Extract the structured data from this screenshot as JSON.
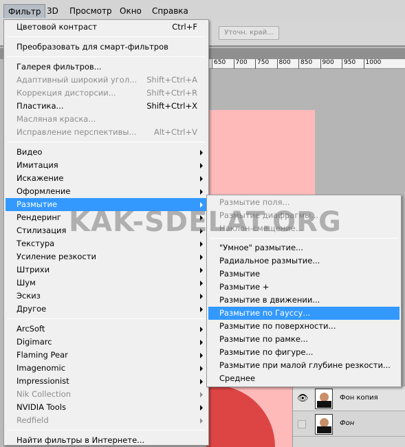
{
  "menubar": [
    "Фильтр",
    "3D",
    "Просмотр",
    "Окно",
    "Справка"
  ],
  "options": {
    "refine_edge": "Уточн. край..."
  },
  "ruler": [
    "650",
    "700",
    "750",
    "800",
    "850",
    "900",
    "950",
    "1000"
  ],
  "watermark": "KAK-SDELAT.ORG",
  "main_menu": [
    {
      "label": "Цветовой контраст",
      "shortcut": "Ctrl+F"
    },
    {
      "sep": true
    },
    {
      "label": "Преобразовать для смарт-фильтров"
    },
    {
      "sep": true
    },
    {
      "label": "Галерея фильтров..."
    },
    {
      "label": "Адаптивный широкий угол...",
      "shortcut": "Shift+Ctrl+A",
      "disabled": true
    },
    {
      "label": "Коррекция дисторсии...",
      "shortcut": "Shift+Ctrl+R",
      "disabled": true
    },
    {
      "label": "Пластика...",
      "shortcut": "Shift+Ctrl+X"
    },
    {
      "label": "Масляная краска...",
      "disabled": true
    },
    {
      "label": "Исправление перспективы...",
      "shortcut": "Alt+Ctrl+V",
      "disabled": true
    },
    {
      "sep": true
    },
    {
      "label": "Видео",
      "submenu": true
    },
    {
      "label": "Имитация",
      "submenu": true
    },
    {
      "label": "Искажение",
      "submenu": true
    },
    {
      "label": "Оформление",
      "submenu": true
    },
    {
      "label": "Размытие",
      "submenu": true,
      "highlighted": true
    },
    {
      "label": "Рендеринг",
      "submenu": true
    },
    {
      "label": "Стилизация",
      "submenu": true
    },
    {
      "label": "Текстура",
      "submenu": true
    },
    {
      "label": "Усиление резкости",
      "submenu": true
    },
    {
      "label": "Штрихи",
      "submenu": true
    },
    {
      "label": "Шум",
      "submenu": true
    },
    {
      "label": "Эскиз",
      "submenu": true
    },
    {
      "label": "Другое",
      "submenu": true
    },
    {
      "sep": true
    },
    {
      "label": "ArcSoft",
      "submenu": true
    },
    {
      "label": "Digimarc",
      "submenu": true
    },
    {
      "label": "Flaming Pear",
      "submenu": true
    },
    {
      "label": "Imagenomic",
      "submenu": true
    },
    {
      "label": "Impressionist",
      "submenu": true
    },
    {
      "label": "Nik Collection",
      "submenu": true,
      "disabled": true
    },
    {
      "label": "NVIDIA Tools",
      "submenu": true
    },
    {
      "label": "Redfield",
      "submenu": true,
      "disabled": true
    },
    {
      "sep": true
    },
    {
      "label": "Найти фильтры в Интернете..."
    }
  ],
  "blur_submenu": [
    {
      "label": "Размытие поля...",
      "disabled": true
    },
    {
      "label": "Размытие диафрагмы...",
      "disabled": true
    },
    {
      "label": "Наклон-смещение...",
      "disabled": true
    },
    {
      "sep": true
    },
    {
      "label": "\"Умное\" размытие..."
    },
    {
      "label": "Радиальное размытие..."
    },
    {
      "label": "Размытие"
    },
    {
      "label": "Размытие +"
    },
    {
      "label": "Размытие в движении..."
    },
    {
      "label": "Размытие по Гауссу...",
      "highlighted": true
    },
    {
      "label": "Размытие по поверхности..."
    },
    {
      "label": "Размытие по рамке..."
    },
    {
      "label": "Размытие по фигуре..."
    },
    {
      "label": "Размытие при малой глубине резкости..."
    },
    {
      "label": "Среднее"
    }
  ],
  "layers": [
    {
      "name": "Фон копия",
      "visible": true
    },
    {
      "name": "Фон",
      "visible": false
    }
  ],
  "colors": {
    "highlight": "#3399ff",
    "disabled": "#8d8d8d"
  }
}
